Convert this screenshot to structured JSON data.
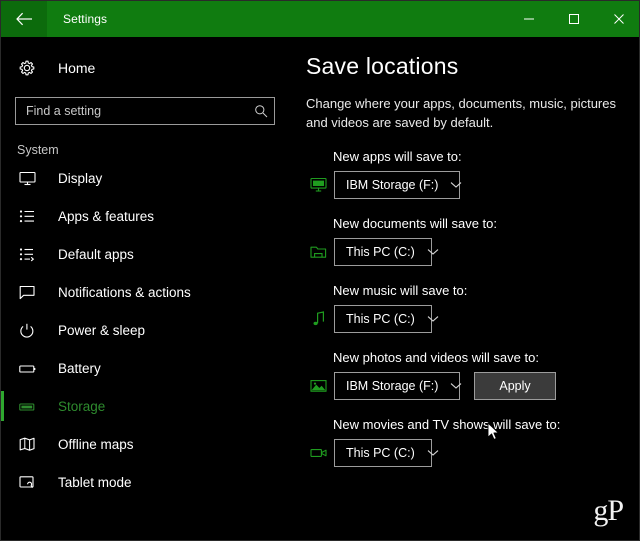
{
  "window": {
    "title": "Settings",
    "back_icon": "back-arrow-icon",
    "minimize_label": "–",
    "maximize_label": "□",
    "close_label": "✕",
    "titlebar_color": "#107c10"
  },
  "sidebar": {
    "home": {
      "label": "Home",
      "icon": "gear-icon"
    },
    "search": {
      "placeholder": "Find a setting",
      "value": "",
      "icon": "search-icon"
    },
    "group_label": "System",
    "selected": "Storage",
    "accent_color": "#2fa72f",
    "items": [
      {
        "label": "Display",
        "icon": "monitor-icon",
        "selected": false
      },
      {
        "label": "Apps & features",
        "icon": "list-icon",
        "selected": false
      },
      {
        "label": "Default apps",
        "icon": "default-apps-icon",
        "selected": false
      },
      {
        "label": "Notifications & actions",
        "icon": "speech-bubble-icon",
        "selected": false
      },
      {
        "label": "Power & sleep",
        "icon": "power-icon",
        "selected": false
      },
      {
        "label": "Battery",
        "icon": "battery-icon",
        "selected": false
      },
      {
        "label": "Storage",
        "icon": "storage-icon",
        "selected": true
      },
      {
        "label": "Offline maps",
        "icon": "map-icon",
        "selected": false
      },
      {
        "label": "Tablet mode",
        "icon": "tablet-icon",
        "selected": false
      }
    ]
  },
  "main": {
    "title": "Save locations",
    "description": "Change where your apps, documents, music, pictures and videos are saved by default.",
    "icon_color": "#1f9c1f",
    "locations": [
      {
        "label": "New apps will save to:",
        "icon": "apps-monitor-icon",
        "value": "IBM Storage (F:)",
        "width_class": "w-apps",
        "has_apply": false
      },
      {
        "label": "New documents will save to:",
        "icon": "folder-icon",
        "value": "This PC (C:)",
        "width_class": "w-docs",
        "has_apply": false
      },
      {
        "label": "New music will save to:",
        "icon": "music-note-icon",
        "value": "This PC (C:)",
        "width_class": "w-music",
        "has_apply": false
      },
      {
        "label": "New photos and videos will save to:",
        "icon": "picture-icon",
        "value": "IBM Storage (F:)",
        "width_class": "w-photos",
        "has_apply": true,
        "apply_label": "Apply"
      },
      {
        "label": "New movies and TV shows will save to:",
        "icon": "video-camera-icon",
        "value": "This PC (C:)",
        "width_class": "w-movies",
        "has_apply": false
      }
    ],
    "watermark": "gP"
  }
}
